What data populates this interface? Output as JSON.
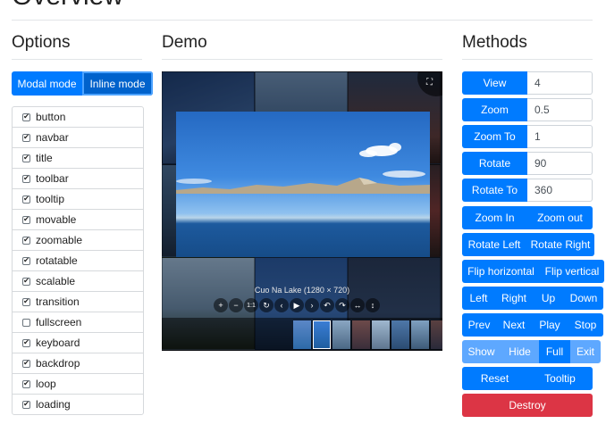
{
  "page": {
    "title": "Overview"
  },
  "options": {
    "title": "Options",
    "modes": [
      "Modal mode",
      "Inline mode"
    ],
    "items": [
      {
        "label": "button",
        "checked": true
      },
      {
        "label": "navbar",
        "checked": true
      },
      {
        "label": "title",
        "checked": true
      },
      {
        "label": "toolbar",
        "checked": true
      },
      {
        "label": "tooltip",
        "checked": true
      },
      {
        "label": "movable",
        "checked": true
      },
      {
        "label": "zoomable",
        "checked": true
      },
      {
        "label": "rotatable",
        "checked": true
      },
      {
        "label": "scalable",
        "checked": true
      },
      {
        "label": "transition",
        "checked": true
      },
      {
        "label": "fullscreen",
        "checked": false
      },
      {
        "label": "keyboard",
        "checked": true
      },
      {
        "label": "backdrop",
        "checked": true
      },
      {
        "label": "loop",
        "checked": true
      },
      {
        "label": "loading",
        "checked": true
      }
    ]
  },
  "demo": {
    "title": "Demo",
    "image_title": "Cuo Na Lake (1280 × 720)",
    "toolbar": [
      "+",
      "−",
      "1:1",
      "↻",
      "‹",
      "▶",
      "›",
      "↶",
      "↷",
      "↔",
      "↕"
    ]
  },
  "methods": {
    "title": "Methods",
    "inputs": [
      {
        "label": "View",
        "value": "4"
      },
      {
        "label": "Zoom",
        "value": "0.5"
      },
      {
        "label": "Zoom To",
        "value": "1"
      },
      {
        "label": "Rotate",
        "value": "90"
      },
      {
        "label": "Rotate To",
        "value": "360"
      }
    ],
    "zoom_group": [
      "Zoom In",
      "Zoom out"
    ],
    "rotate_group": [
      "Rotate Left",
      "Rotate Right"
    ],
    "flip_group": [
      "Flip horizontal",
      "Flip vertical"
    ],
    "move_group": [
      "Left",
      "Right",
      "Up",
      "Down"
    ],
    "play_group": [
      "Prev",
      "Next",
      "Play",
      "Stop"
    ],
    "show_group": [
      "Show",
      "Hide",
      "Full",
      "Exit"
    ],
    "reset_group": [
      "Reset",
      "Tooltip"
    ],
    "destroy": "Destroy"
  }
}
